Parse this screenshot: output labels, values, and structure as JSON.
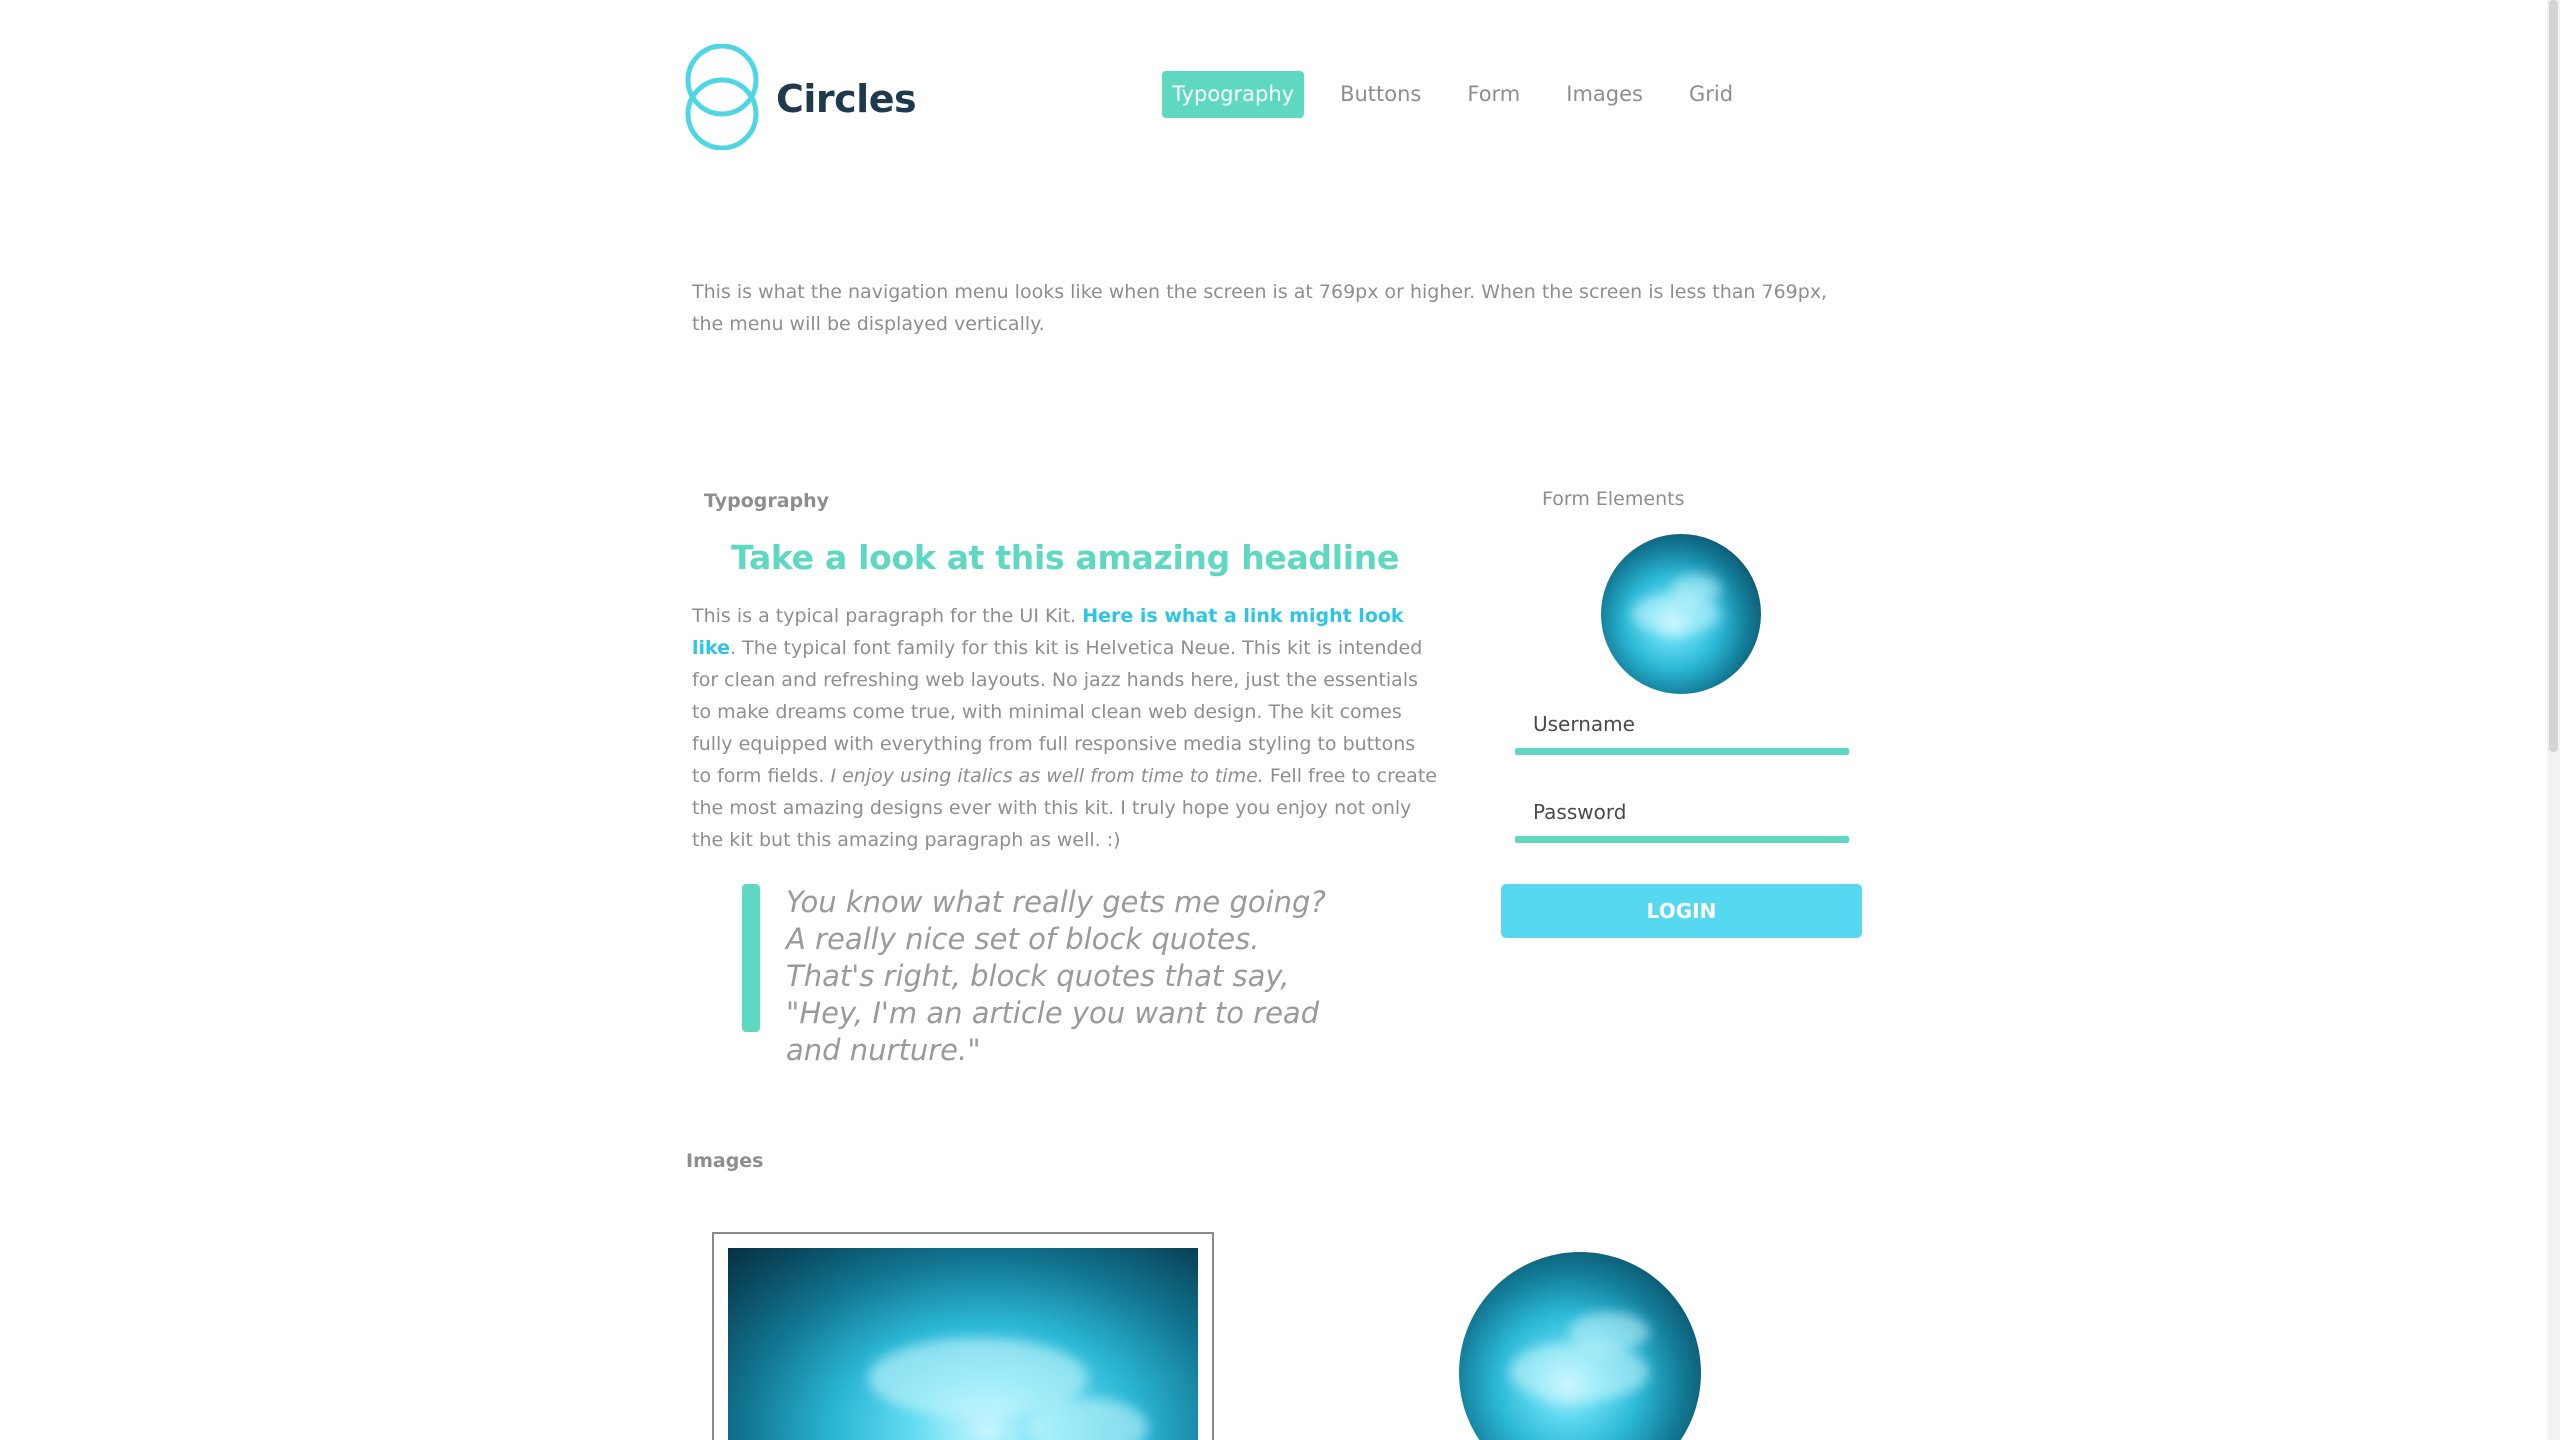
{
  "brand": {
    "name": "Circles",
    "accent_color": "#5fd8c2",
    "link_color": "#2ec4e6",
    "logo_icon": "two-circles-logo-icon"
  },
  "nav": {
    "items": [
      {
        "label": "Typography",
        "active": true
      },
      {
        "label": "Buttons",
        "active": false
      },
      {
        "label": "Form",
        "active": false
      },
      {
        "label": "Images",
        "active": false
      },
      {
        "label": "Grid",
        "active": false
      }
    ]
  },
  "intro": {
    "text": "This is what the navigation menu looks like when the screen is at 769px or higher. When the screen is less than 769px, the menu will be displayed vertically."
  },
  "typography": {
    "section_label": "Typography",
    "headline": "Take a look at this amazing headline",
    "paragraph_start": "This is a typical paragraph for the UI Kit. ",
    "link_text": "Here is what a link might look like",
    "paragraph_middle": ". The typical font family for this kit is Helvetica Neue. This kit is intended for clean and refreshing web layouts. No jazz hands here, just the essentials to make dreams come true, with minimal clean web design. The kit comes fully equipped with everything from full responsive media styling to buttons to form fields. ",
    "italic_text": "I enjoy using italics as well from time to time.",
    "paragraph_end": " Fell free to create the most amazing designs ever with this kit. I truly hope you enjoy not only the kit but this amazing paragraph as well. :)",
    "blockquote": "You know what really gets me going? A really nice set of block quotes. That's right, block quotes that say, \"Hey, I'm an article you want to read and nurture.\""
  },
  "form": {
    "section_label": "Form Elements",
    "username_placeholder": "Username",
    "password_placeholder": "Password",
    "login_label": "LOGIN"
  },
  "images": {
    "section_label": "Images"
  }
}
